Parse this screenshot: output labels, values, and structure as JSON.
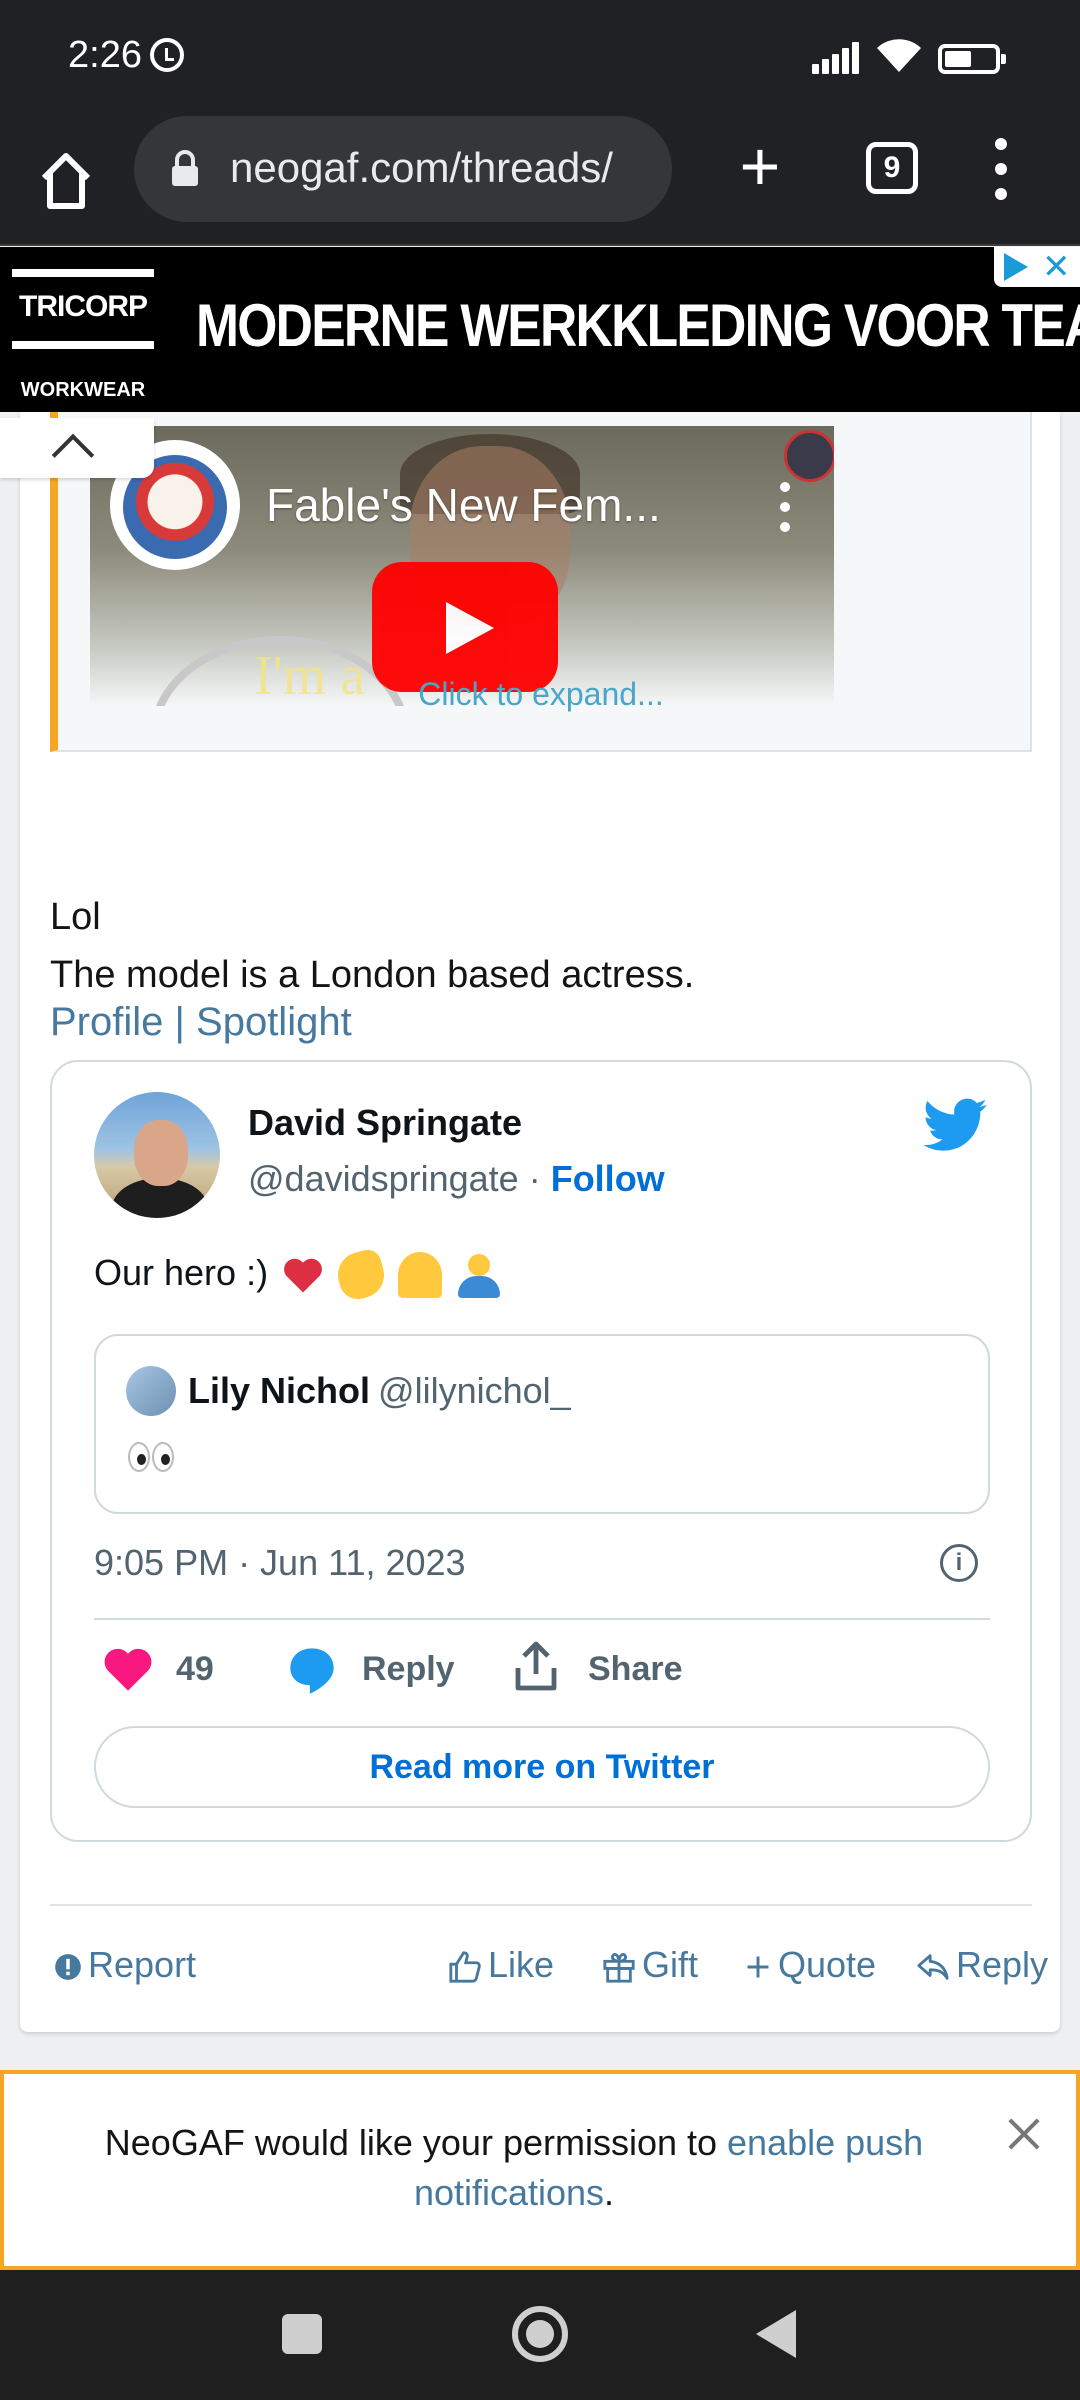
{
  "status_bar": {
    "time": "2:26"
  },
  "browser": {
    "url": "neogaf.com/threads/",
    "tab_count": "9"
  },
  "ad": {
    "logo_brand": "TRICORP",
    "logo_sub": "WORKWEAR",
    "text": "MODERNE WERKKLEDING VOOR TEAMS."
  },
  "quote": {
    "video_title": "Fable's New Fem...",
    "video_overlay_text": "I'm a",
    "expand_label": "Click to expand..."
  },
  "post": {
    "line1": "Lol",
    "line2": "The model is a London based actress.",
    "link_profile": "Profile",
    "link_separator": " | ",
    "link_spotlight": "Spotlight"
  },
  "tweet": {
    "author_name": "David Springate",
    "author_handle": "@davidspringate",
    "separator": " · ",
    "follow_label": "Follow",
    "text": "Our hero :)",
    "quoted": {
      "name": "Lily Nichol",
      "handle": "@lilynichol_"
    },
    "timestamp": "9:05 PM · Jun 11, 2023",
    "like_count": "49",
    "reply_label": "Reply",
    "share_label": "Share",
    "read_more_label": "Read more on Twitter",
    "colors": {
      "like": "#f91880",
      "reply": "#1d9bf0",
      "link": "#006fd6"
    }
  },
  "post_actions": {
    "report": "Report",
    "like": "Like",
    "gift": "Gift",
    "quote": "Quote",
    "reply": "Reply"
  },
  "push_notice": {
    "text_before": "NeoGAF would like your permission to ",
    "link_text": "enable push notifications",
    "text_after": "."
  },
  "colors": {
    "accent": "#47799f",
    "quote_border": "#f5a623",
    "ad_bg": "#000000"
  }
}
